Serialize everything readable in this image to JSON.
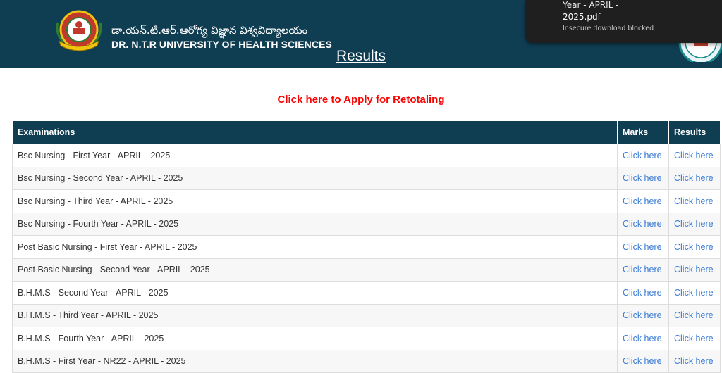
{
  "header": {
    "title_telugu": "డా.యన్.టి.ఆర్.ఆరోగ్య విజ్ఞాన విశ్వవిద్యాలయం",
    "title_english": "DR. N.T.R UNIVERSITY OF HEALTH SCIENCES",
    "page_heading": "Results"
  },
  "download_toast": {
    "filename_line1": "Year - APRIL -",
    "filename_line2": "2025.pdf",
    "status": "Insecure download blocked"
  },
  "retotal_link": "Click here to Apply for Retotaling",
  "table": {
    "headers": {
      "examinations": "Examinations",
      "marks": "Marks",
      "results": "Results"
    },
    "rows": [
      {
        "exam": "Bsc Nursing - First Year - APRIL - 2025",
        "marks": "Click here",
        "results": "Click here"
      },
      {
        "exam": "Bsc Nursing - Second Year - APRIL - 2025",
        "marks": "Click here",
        "results": "Click here"
      },
      {
        "exam": "Bsc Nursing - Third Year - APRIL - 2025",
        "marks": "Click here",
        "results": "Click here"
      },
      {
        "exam": "Bsc Nursing - Fourth Year - APRIL - 2025",
        "marks": "Click here",
        "results": "Click here"
      },
      {
        "exam": "Post Basic Nursing - First Year - APRIL - 2025",
        "marks": "Click here",
        "results": "Click here"
      },
      {
        "exam": "Post Basic Nursing - Second Year - APRIL - 2025",
        "marks": "Click here",
        "results": "Click here"
      },
      {
        "exam": "B.H.M.S - Second Year - APRIL - 2025",
        "marks": "Click here",
        "results": "Click here"
      },
      {
        "exam": "B.H.M.S - Third Year - APRIL - 2025",
        "marks": "Click here",
        "results": "Click here"
      },
      {
        "exam": "B.H.M.S - Fourth Year - APRIL - 2025",
        "marks": "Click here",
        "results": "Click here"
      },
      {
        "exam": "B.H.M.S - First Year - NR22 - APRIL - 2025",
        "marks": "Click here",
        "results": "Click here"
      }
    ]
  }
}
